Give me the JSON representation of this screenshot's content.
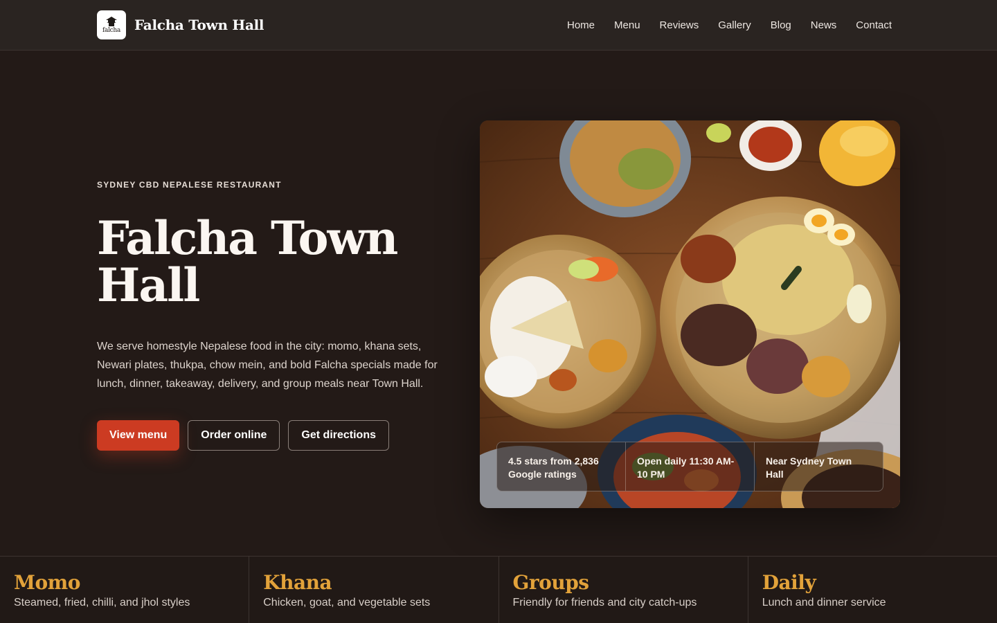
{
  "brand": {
    "logo_text": "falcha",
    "name": "Falcha Town Hall"
  },
  "nav": {
    "items": [
      "Home",
      "Menu",
      "Reviews",
      "Gallery",
      "Blog",
      "News",
      "Contact"
    ]
  },
  "hero": {
    "eyebrow": "SYDNEY CBD NEPALESE RESTAURANT",
    "title": "Falcha Town Hall",
    "description": "We serve homestyle Nepalese food in the city: momo, khana sets, Newari plates, thukpa, chow mein, and bold Falcha specials made for lunch, dinner, takeaway, delivery, and group meals near Town Hall.",
    "buttons": {
      "view_menu": "View menu",
      "order_online": "Order online",
      "get_directions": "Get directions"
    },
    "stats": [
      "4.5 stars from 2,836 Google ratings",
      "Open daily 11:30 AM-10 PM",
      "Near Sydney Town Hall"
    ]
  },
  "features": [
    {
      "title": "Momo",
      "subtitle": "Steamed, fried, chilli, and jhol styles"
    },
    {
      "title": "Khana",
      "subtitle": "Chicken, goat, and vegetable sets"
    },
    {
      "title": "Groups",
      "subtitle": "Friendly for friends and city catch-ups"
    },
    {
      "title": "Daily",
      "subtitle": "Lunch and dinner service"
    }
  ],
  "colors": {
    "background": "#231a17",
    "header": "#2a2421",
    "accent_red": "#cc3b22",
    "accent_gold": "#e2a23a"
  }
}
